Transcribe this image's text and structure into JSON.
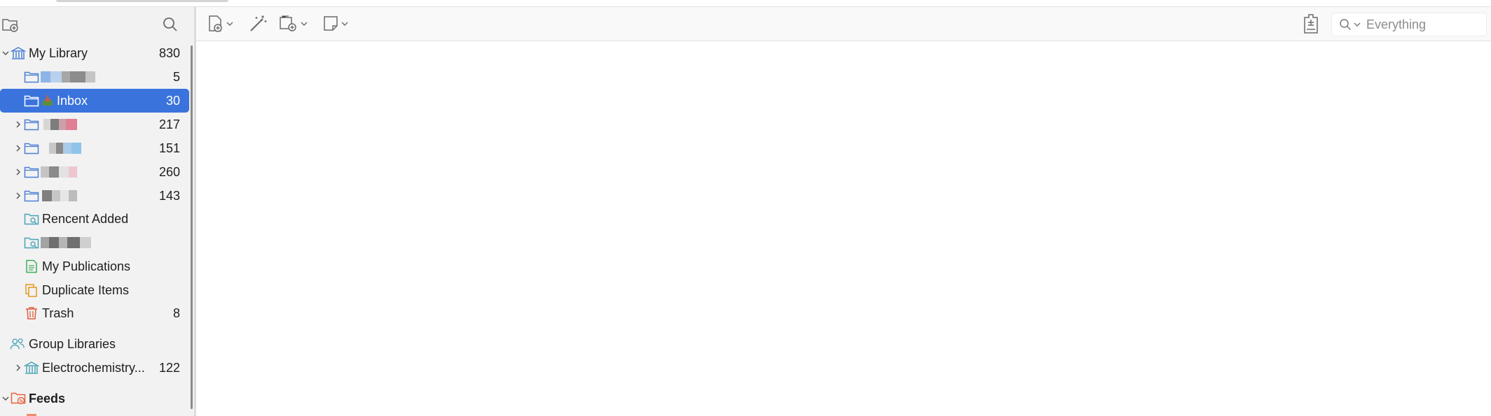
{
  "sidebar": {
    "library": {
      "label": "My Library",
      "count": "830"
    },
    "collections": [
      {
        "label": "",
        "count": "5",
        "expandable": false,
        "blurred": true
      },
      {
        "label": "Inbox",
        "count": "30",
        "expandable": false,
        "selected": true
      },
      {
        "label": "",
        "count": "217",
        "expandable": true,
        "blurred": true
      },
      {
        "label": "",
        "count": "151",
        "expandable": true,
        "blurred": true
      },
      {
        "label": "",
        "count": "260",
        "expandable": true,
        "blurred": true
      },
      {
        "label": "",
        "count": "143",
        "expandable": true,
        "blurred": true
      }
    ],
    "saved_searches": [
      {
        "label": "Rencent Added",
        "count": ""
      },
      {
        "label": "",
        "count": "",
        "blurred": true
      }
    ],
    "special": [
      {
        "label": "My Publications",
        "count": ""
      },
      {
        "label": "Duplicate Items",
        "count": ""
      },
      {
        "label": "Trash",
        "count": "8"
      }
    ],
    "group_header": {
      "label": "Group Libraries"
    },
    "groups": [
      {
        "label": "Electrochemistry...",
        "count": "122"
      }
    ],
    "feeds_header": {
      "label": "Feeds"
    }
  },
  "toolbar": {
    "search_placeholder": "Everything"
  },
  "colors": {
    "selection": "#3a73dc",
    "folder": "#4b7fd4",
    "library": "#4b7fd4",
    "publications": "#3fae5a",
    "duplicates": "#e39a1c",
    "trash": "#e05c3d",
    "feeds": "#e8613a"
  }
}
